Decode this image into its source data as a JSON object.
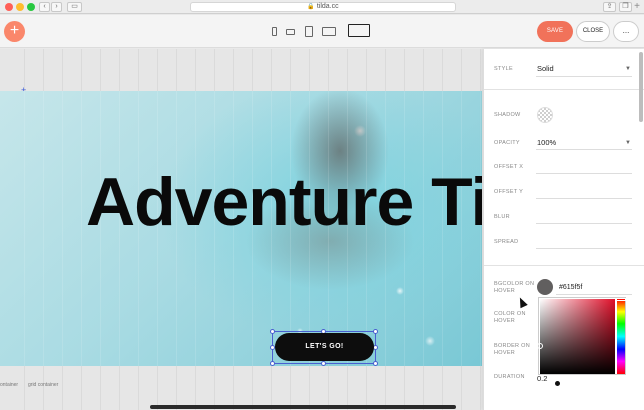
{
  "browser": {
    "url": "tilda.cc",
    "back_icon": "‹",
    "forward_icon": "›"
  },
  "toolbar": {
    "add_label": "+",
    "save_label": "SAVE",
    "close_label": "CLOSE",
    "more_label": "..."
  },
  "canvas": {
    "hero_title": "Adventure Ti",
    "cta_label": "LET'S GO!",
    "bottom_labels": [
      "ontainer",
      "grid container"
    ]
  },
  "panel": {
    "style": {
      "label": "STYLE",
      "value": "Solid"
    },
    "shadow": {
      "label": "SHADOW"
    },
    "opacity": {
      "label": "OPACITY",
      "value": "100%"
    },
    "offset_x": {
      "label": "OFFSET X"
    },
    "offset_y": {
      "label": "OFFSET Y"
    },
    "blur": {
      "label": "BLUR"
    },
    "spread": {
      "label": "SPREAD"
    },
    "bgcolor_hover": {
      "label_line1": "BGCOLOR ON",
      "label_line2": "HOVER",
      "value": "#615f5f"
    },
    "color_hover": {
      "label_line1": "COLOR ON",
      "label_line2": "HOVER"
    },
    "border_hover": {
      "label_line1": "BORDER ON",
      "label_line2": "HOVER"
    },
    "duration": {
      "label": "DURATION",
      "value": "0.2"
    }
  },
  "colors": {
    "accent": "#f1725a",
    "add_button": "#fa876b",
    "cta_background": "#0d0d0d",
    "hover_bg": "#615f5f",
    "selection": "#4a5fd0"
  }
}
